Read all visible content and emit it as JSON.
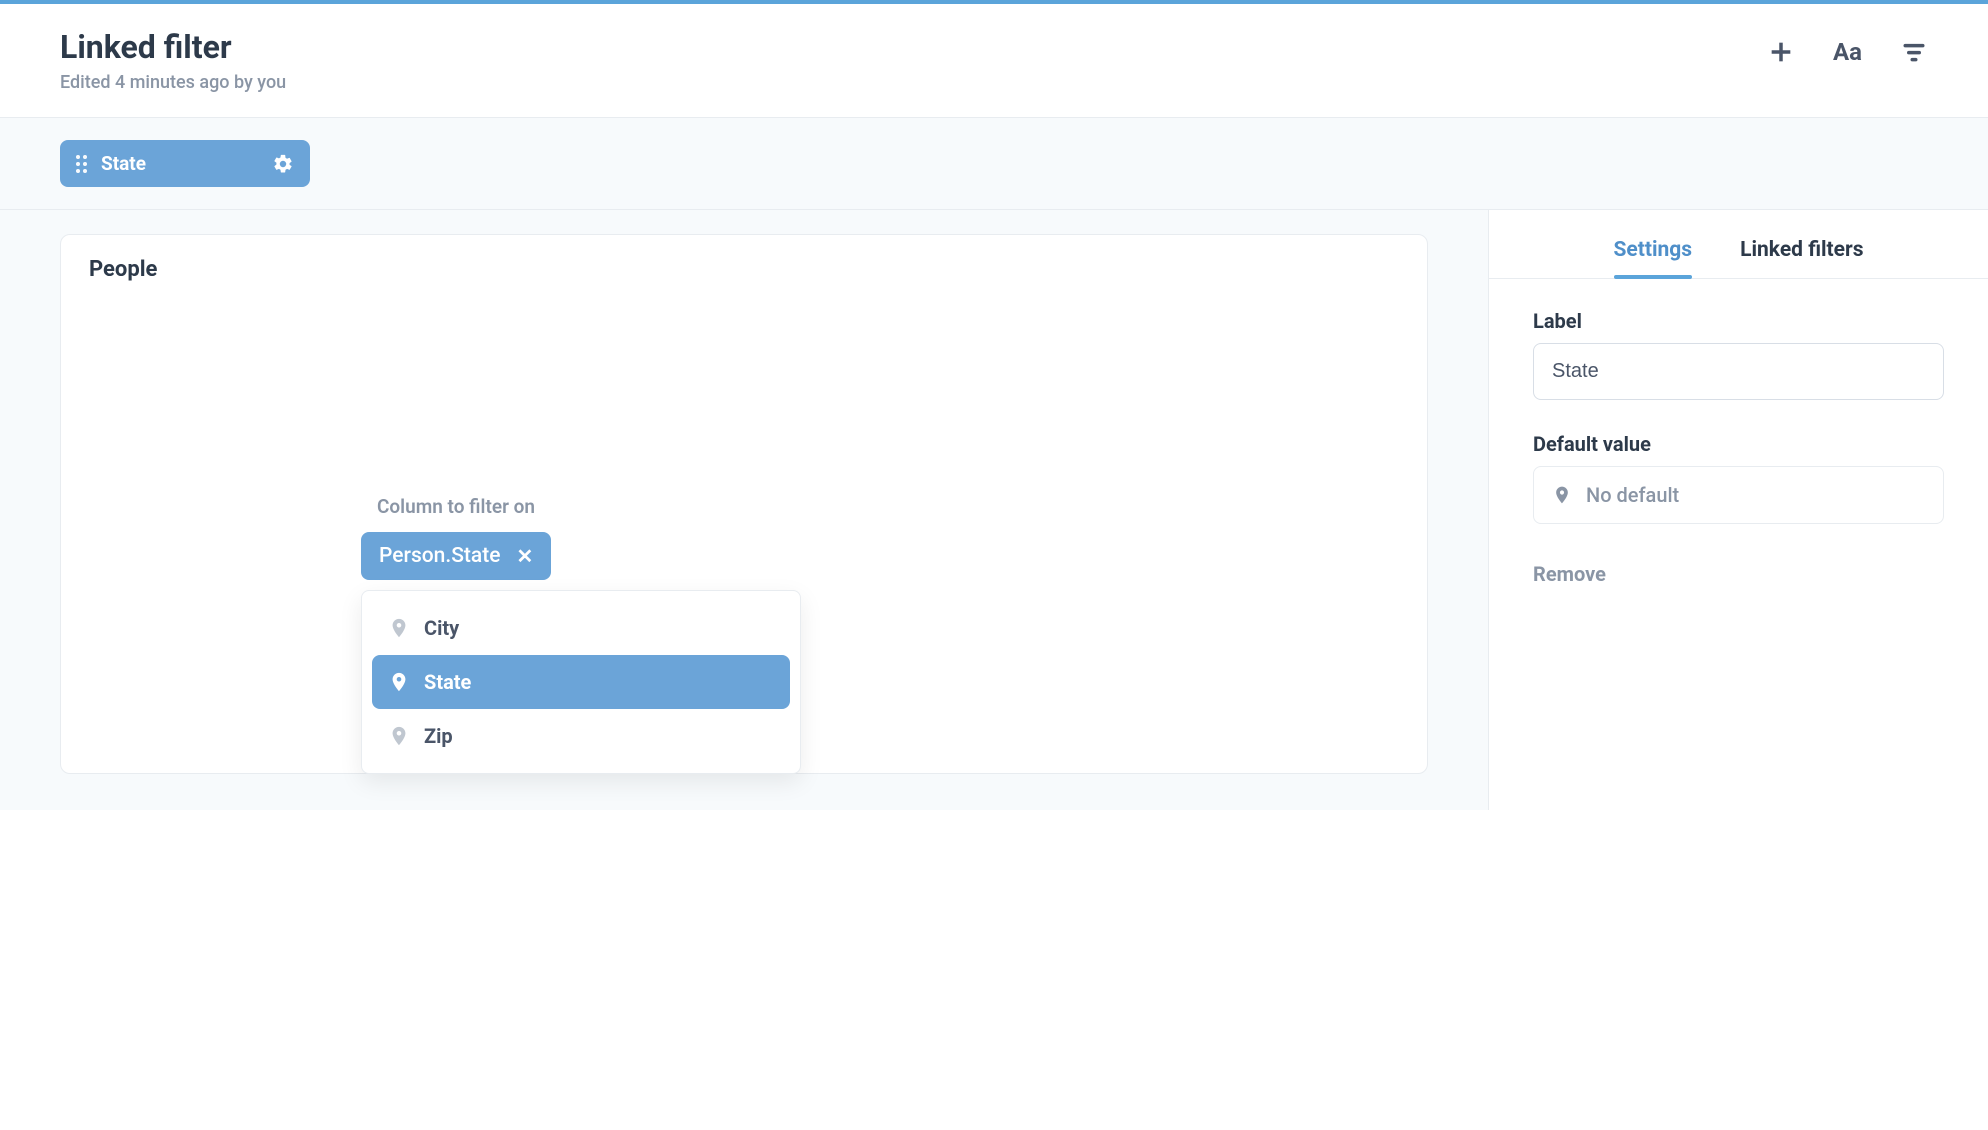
{
  "header": {
    "title": "Linked filter",
    "subtitle": "Edited 4 minutes ago by you"
  },
  "filter_bar": {
    "chip_label": "State"
  },
  "card": {
    "title": "People"
  },
  "column_filter": {
    "label": "Column to filter on",
    "token": "Person.State",
    "options": [
      {
        "label": "City",
        "selected": false
      },
      {
        "label": "State",
        "selected": true
      },
      {
        "label": "Zip",
        "selected": false
      }
    ]
  },
  "side_panel": {
    "tabs": {
      "settings": "Settings",
      "linked": "Linked filters"
    },
    "label_field": {
      "label": "Label",
      "value": "State"
    },
    "default_value": {
      "label": "Default value",
      "placeholder": "No default"
    },
    "remove": "Remove"
  },
  "icons": {
    "plus": "plus-icon",
    "text": "text-style-icon",
    "filter": "filter-icon",
    "gear": "gear-icon",
    "pin": "location-pin-icon"
  }
}
